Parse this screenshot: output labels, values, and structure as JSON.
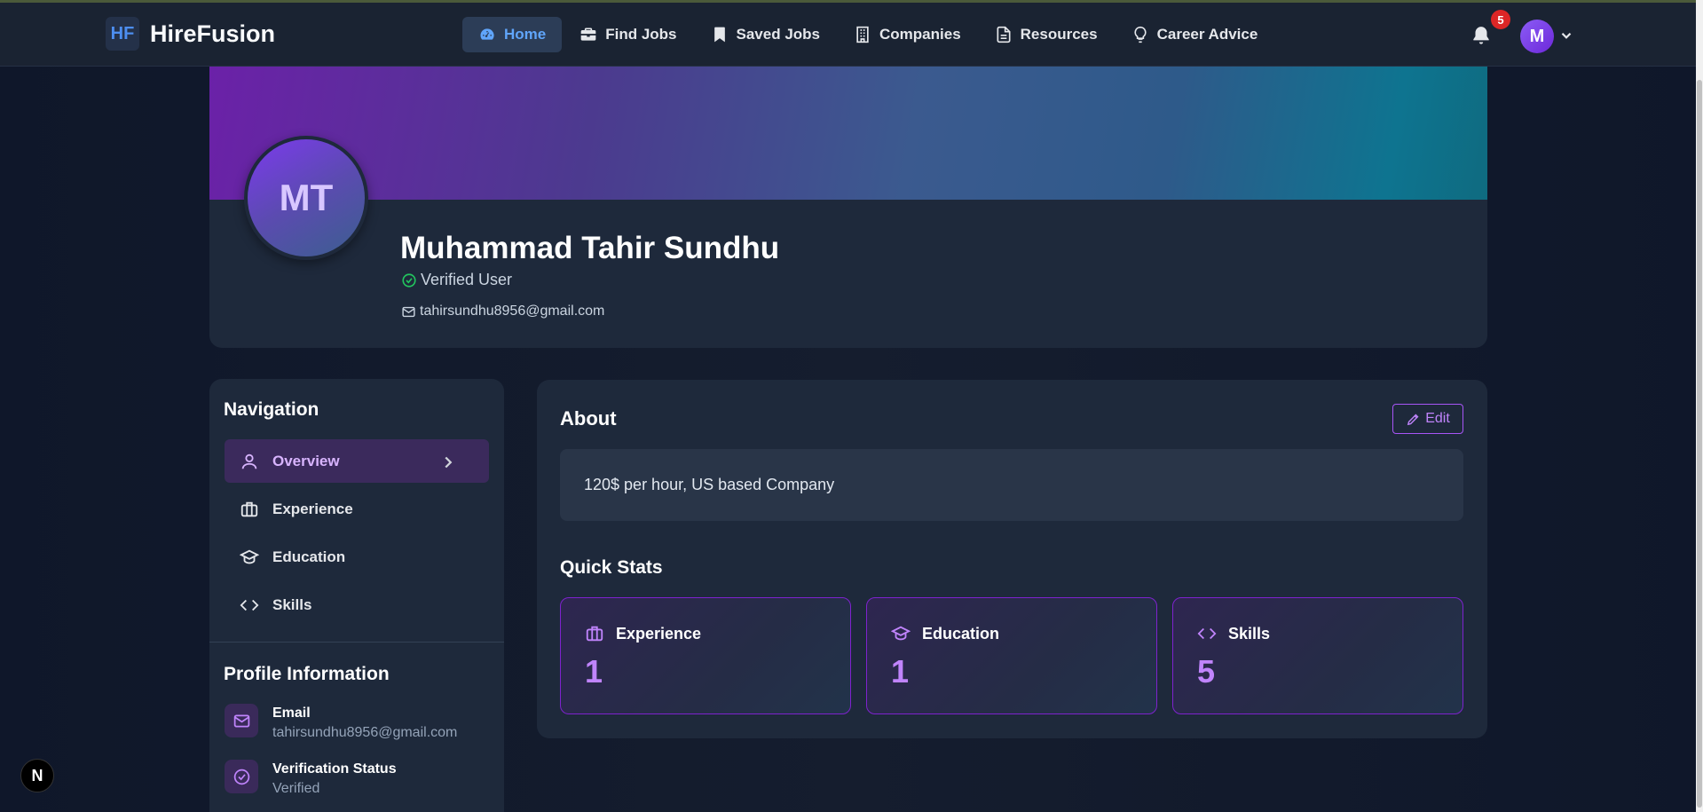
{
  "brand": {
    "mark": "HF",
    "name": "HireFusion"
  },
  "nav": [
    {
      "label": "Home",
      "icon": "dashboard-icon",
      "active": true
    },
    {
      "label": "Find Jobs",
      "icon": "briefcase-icon"
    },
    {
      "label": "Saved Jobs",
      "icon": "bookmark-icon"
    },
    {
      "label": "Companies",
      "icon": "building-icon"
    },
    {
      "label": "Resources",
      "icon": "document-icon"
    },
    {
      "label": "Career Advice",
      "icon": "lightbulb-icon"
    }
  ],
  "notifications": {
    "count": "5"
  },
  "user_menu": {
    "initial": "M"
  },
  "profile": {
    "initials": "MT",
    "name": "Muhammad Tahir Sundhu",
    "verified_label": "Verified User",
    "email": "tahirsundhu8956@gmail.com"
  },
  "sidebar": {
    "title": "Navigation",
    "items": [
      {
        "label": "Overview",
        "icon": "user-icon",
        "active": true
      },
      {
        "label": "Experience",
        "icon": "briefcase-icon"
      },
      {
        "label": "Education",
        "icon": "graduation-cap-icon"
      },
      {
        "label": "Skills",
        "icon": "code-icon"
      }
    ],
    "profile_info_title": "Profile Information",
    "profile_info": [
      {
        "label": "Email",
        "value": "tahirsundhu8956@gmail.com",
        "icon": "mail-icon"
      },
      {
        "label": "Verification Status",
        "value": "Verified",
        "icon": "check-circle-icon"
      }
    ]
  },
  "about": {
    "title": "About",
    "edit_label": "Edit",
    "text": "120$ per hour, US based Company"
  },
  "quick_stats": {
    "title": "Quick Stats",
    "items": [
      {
        "label": "Experience",
        "value": "1",
        "icon": "briefcase-icon"
      },
      {
        "label": "Education",
        "value": "1",
        "icon": "graduation-cap-icon"
      },
      {
        "label": "Skills",
        "value": "5",
        "icon": "code-icon"
      }
    ]
  },
  "dev_badge": {
    "label": "N"
  },
  "colors": {
    "accent": "#a855f7",
    "nav_active": "#60a5fa",
    "verified": "#22c55e",
    "badge": "#dc2626"
  }
}
